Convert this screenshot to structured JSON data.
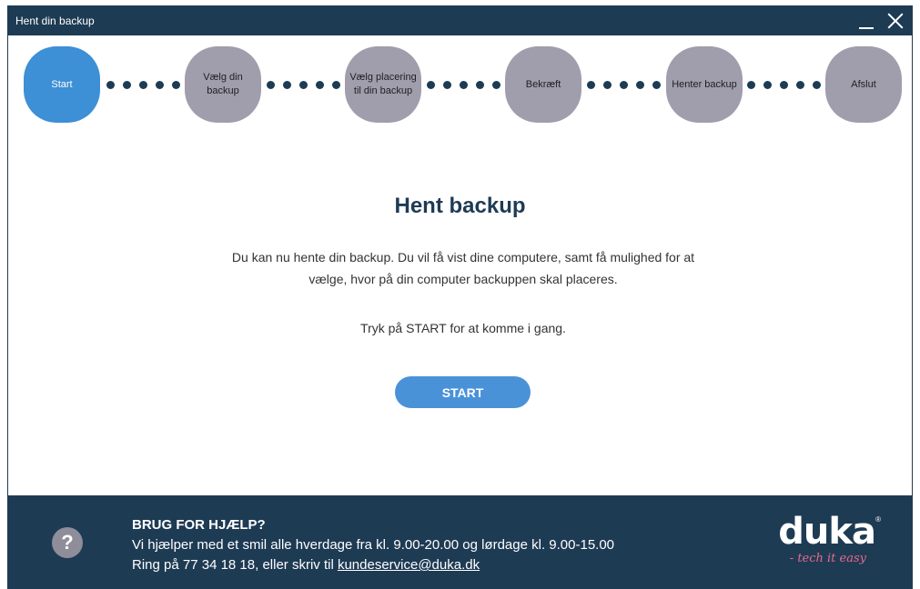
{
  "window": {
    "title": "Hent din backup"
  },
  "steps": [
    {
      "label": "Start",
      "active": true
    },
    {
      "label": "Vælg din backup",
      "active": false
    },
    {
      "label": "Vælg placering til din backup",
      "active": false
    },
    {
      "label": "Bekræft",
      "active": false
    },
    {
      "label": "Henter backup",
      "active": false
    },
    {
      "label": "Afslut",
      "active": false
    }
  ],
  "main": {
    "title": "Hent backup",
    "description_line1": "Du kan nu hente din backup. Du vil få vist dine computere, samt få mulighed for at",
    "description_line2": "vælge, hvor på din computer backuppen skal placeres.",
    "instruction": "Tryk på START for at komme i gang.",
    "start_label": "START"
  },
  "footer": {
    "help_icon": "?",
    "heading": "BRUG FOR HJÆLP?",
    "line1": "Vi hjælper med et smil alle hverdage fra kl. 9.00-20.00 og lørdage kl. 9.00-15.00",
    "line2_prefix": "Ring på 77 34 18 18, eller skriv til ",
    "email": "kundeservice@duka.dk",
    "logo_text": "duka",
    "logo_registered": "®",
    "logo_tagline": "- tech it easy"
  },
  "colors": {
    "navy": "#1e3b54",
    "active_step": "#3d8fd6",
    "inactive_step": "#a09eac",
    "button": "#4a92d8",
    "tagline_pink": "#e86a8a"
  },
  "icons": {
    "minimize": "minimize-icon",
    "close": "close-icon",
    "help": "question-mark-icon"
  }
}
